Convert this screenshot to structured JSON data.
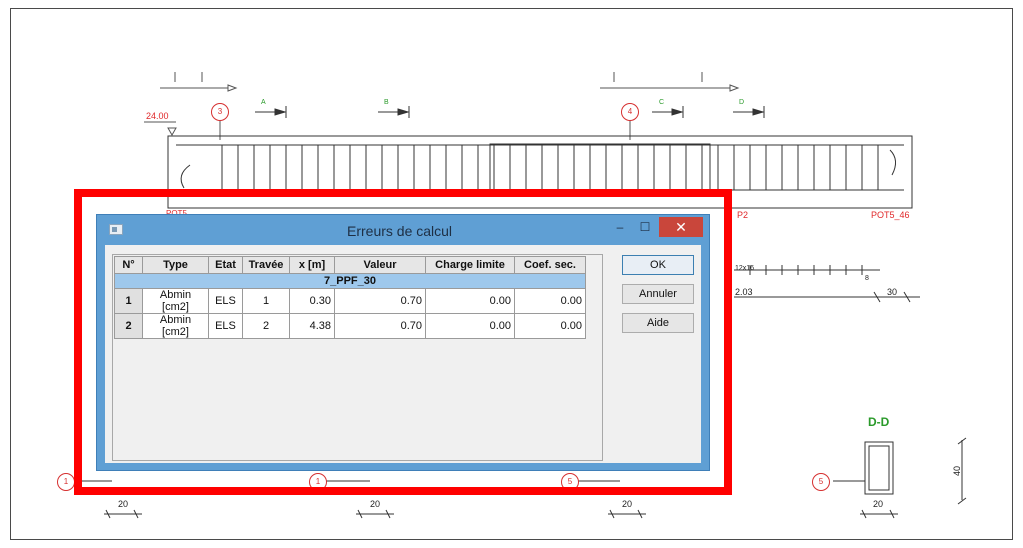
{
  "drawing": {
    "level_label": "24.00",
    "section_marks": [
      "A",
      "B",
      "C",
      "D"
    ],
    "axis_numbers_top": [
      "3",
      "4"
    ],
    "axis_numbers_bottom": [
      "1",
      "1",
      "5",
      "5"
    ],
    "beam_label_left": "POT5",
    "beam_label_right": "POT5_46",
    "span_label": "P2",
    "rebar_label": "12x16",
    "rebar_small_label": "8",
    "dim_value_a": "2.03",
    "dim_value_b": "30",
    "section_title": "D-D",
    "dim_bottom": [
      "20",
      "20",
      "20",
      "20"
    ],
    "dim_height": "40"
  },
  "dialog": {
    "title": "Erreurs de calcul",
    "minimize_glyph": "–",
    "maximize_glyph": "☐",
    "close_glyph": "✕",
    "columns": [
      "N°",
      "Type",
      "Etat",
      "Travée",
      "x [m]",
      "Valeur",
      "Charge limite",
      "Coef. sec."
    ],
    "group_label": "7_PPF_30",
    "rows": [
      {
        "n": "1",
        "type": "Abmin [cm2]",
        "etat": "ELS",
        "travee": "1",
        "x": "0.30",
        "valeur": "0.70",
        "charge": "0.00",
        "coef": "0.00"
      },
      {
        "n": "2",
        "type": "Abmin [cm2]",
        "etat": "ELS",
        "travee": "2",
        "x": "4.38",
        "valeur": "0.70",
        "charge": "0.00",
        "coef": "0.00"
      }
    ],
    "buttons": {
      "ok": "OK",
      "cancel": "Annuler",
      "help": "Aide"
    }
  },
  "colors": {
    "highlight": "#ff0000",
    "dialog_frame": "#5f9fd4",
    "group_row": "#9ec8ec",
    "close_button": "#c9463b"
  }
}
